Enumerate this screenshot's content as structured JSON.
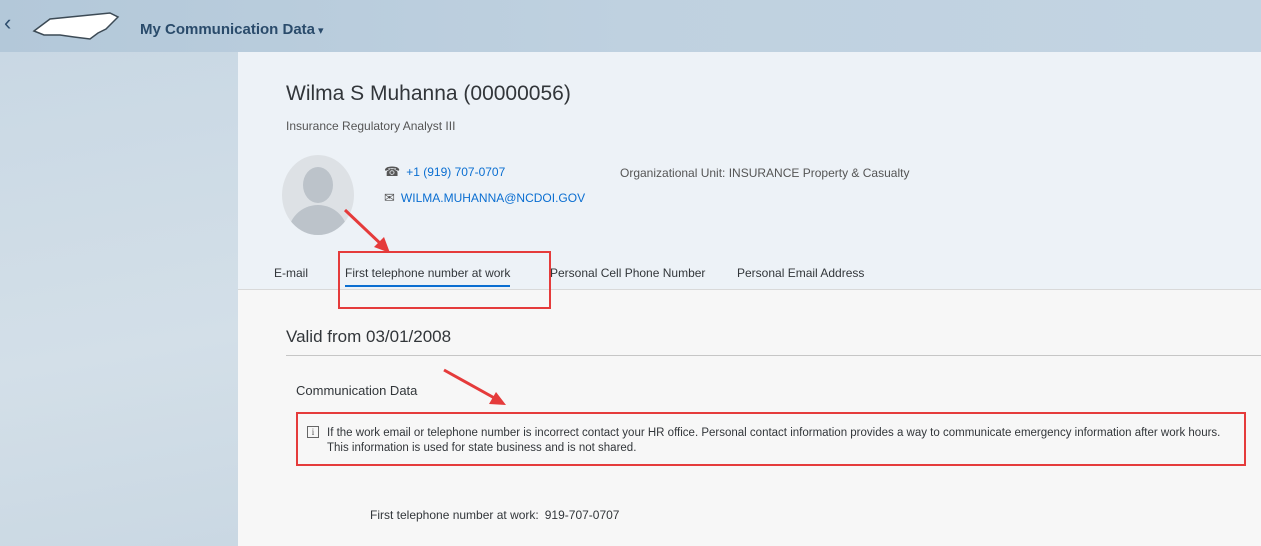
{
  "shell": {
    "back_glyph": "‹",
    "app_title": "My Communication Data",
    "menu_glyph": "▾"
  },
  "employee": {
    "name": "Wilma S Muhanna (00000056)",
    "job_title": "Insurance Regulatory Analyst III",
    "phone": "+1 (919) 707-0707",
    "email": "WILMA.MUHANNA@NCDOI.GOV",
    "org_unit": "Organizational Unit: INSURANCE Property & Casualty"
  },
  "tabs": [
    {
      "label": "E-mail"
    },
    {
      "label": "First telephone number at work",
      "selected": true
    },
    {
      "label": "Personal Cell Phone Number"
    },
    {
      "label": "Personal Email Address"
    }
  ],
  "content": {
    "valid_from": "Valid from 03/01/2008",
    "section_title": "Communication Data",
    "info_icon": "i",
    "info_text": "If the work email or telephone number is incorrect contact your HR office. Personal contact information provides a way to communicate emergency information after work hours. This information is used for state business and is not shared.",
    "field_label": "First telephone number at work:",
    "field_value": "919-707-0707"
  },
  "icons": {
    "phone": "phone-icon",
    "email": "envelope-icon",
    "info": "info-icon",
    "logo": "north-carolina-logo"
  },
  "colors": {
    "link": "#0a6ed1",
    "annotation": "#e53b3b",
    "shell": "#bfd1e0"
  }
}
